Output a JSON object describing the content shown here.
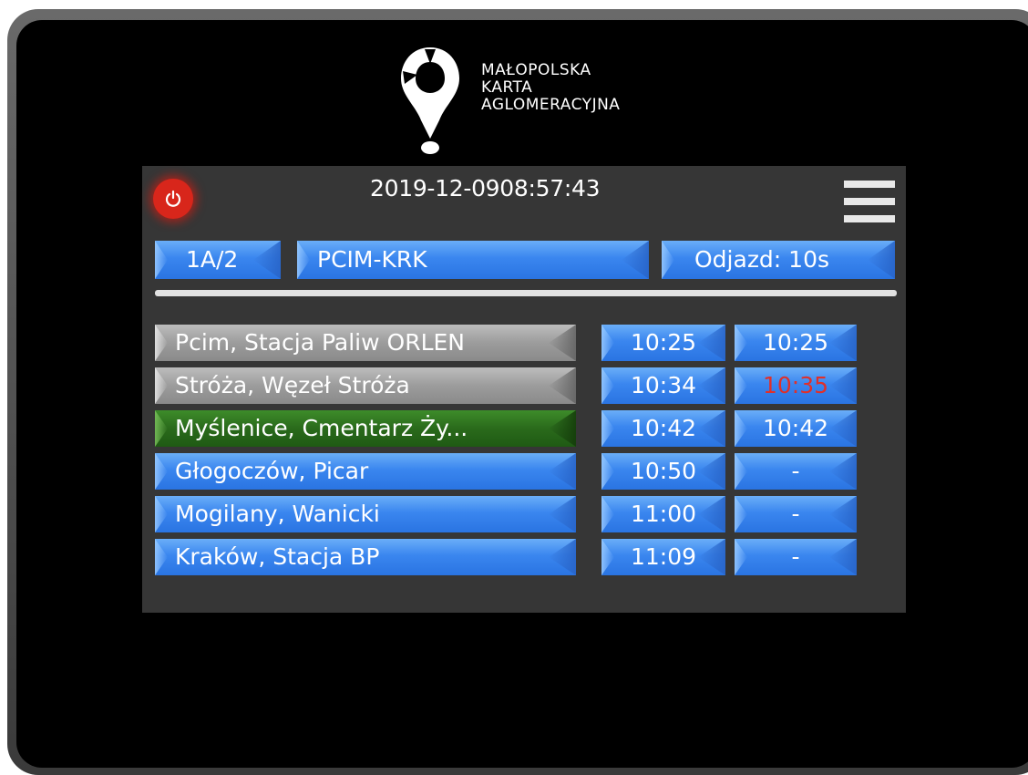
{
  "brand": {
    "lines": [
      "MAŁOPOLSKA",
      "KARTA",
      "AGLOMERACYJNA"
    ]
  },
  "status": {
    "date": "2019-12-09",
    "time": "08:57:43"
  },
  "route": {
    "line_id": "1A/2",
    "name": "PCIM-KRK",
    "departure": "Odjazd: 10s"
  },
  "progress_fraction": 1.0,
  "stops": [
    {
      "name": "Pcim, Stacja Paliw ORLEN",
      "scheduled": "10:25",
      "actual": "10:25",
      "state": "passed"
    },
    {
      "name": "Stróża, Węzeł Stróża",
      "scheduled": "10:34",
      "actual": "10:35",
      "state": "passed",
      "late": true
    },
    {
      "name": "Myślenice, Cmentarz Ży...",
      "scheduled": "10:42",
      "actual": "10:42",
      "state": "current"
    },
    {
      "name": "Głogoczów, Picar",
      "scheduled": "10:50",
      "actual": "-",
      "state": "upcoming"
    },
    {
      "name": "Mogilany, Wanicki",
      "scheduled": "11:00",
      "actual": "-",
      "state": "upcoming"
    },
    {
      "name": "Kraków, Stacja BP",
      "scheduled": "11:09",
      "actual": "-",
      "state": "upcoming"
    }
  ],
  "colors": {
    "button_blue": "#3a86ef",
    "passed_grey": "#9c9c9c",
    "current_green": "#2a6a1b",
    "power_red": "#d8261b",
    "late_red": "#e0302a",
    "panel": "#363636"
  },
  "icons": {
    "power": "power-icon",
    "menu": "hamburger-menu-icon",
    "logo": "location-pin-logo"
  }
}
